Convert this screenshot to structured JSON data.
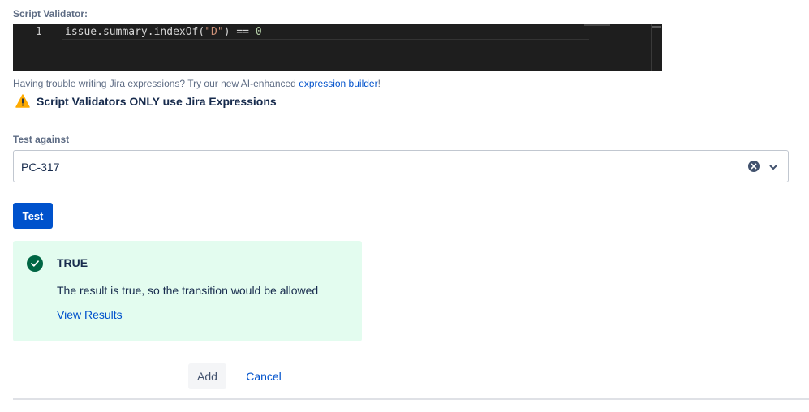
{
  "validator": {
    "label": "Script Validator:",
    "line_number": "1",
    "code_tokens": {
      "t1": "issue",
      "t2": ".",
      "t3": "summary",
      "t4": ".",
      "t5": "indexOf",
      "t6": "(",
      "t7": "\"D\"",
      "t8": ")",
      "t9": " == ",
      "t10": "0"
    }
  },
  "help": {
    "text": "Having trouble writing Jira expressions? Try our new AI-enhanced ",
    "link": "expression builder",
    "suffix": "!"
  },
  "warning": {
    "icon": "warning-icon",
    "text": "Script Validators ONLY use Jira Expressions",
    "color": "#ffab00"
  },
  "test_against": {
    "label": "Test against",
    "value": "PC-317"
  },
  "test_button": {
    "label": "Test",
    "color": "#0052cc"
  },
  "result": {
    "icon": "check-circle-icon",
    "title": "TRUE",
    "message": "The result is true, so the transition would be allowed",
    "link": "View Results",
    "background": "#e3fcef",
    "icon_color": "#006644"
  },
  "footer": {
    "add_label": "Add",
    "cancel_label": "Cancel"
  }
}
